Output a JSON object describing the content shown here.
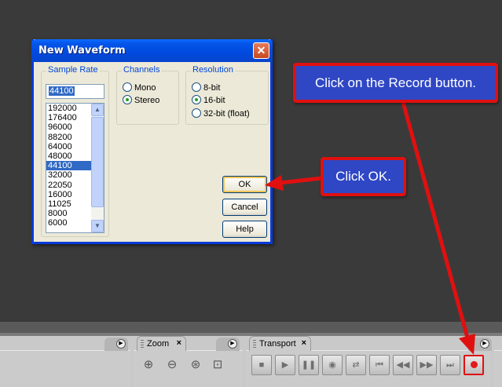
{
  "dialog": {
    "title": "New Waveform",
    "close_glyph": "✕",
    "sample_rate": {
      "label": "Sample Rate",
      "value": "44100",
      "options": [
        "192000",
        "176400",
        "96000",
        "88200",
        "64000",
        "48000",
        "44100",
        "32000",
        "22050",
        "16000",
        "11025",
        "8000",
        "6000"
      ],
      "selected": "44100"
    },
    "channels": {
      "label": "Channels",
      "options": [
        "Mono",
        "Stereo"
      ],
      "selected": "Stereo"
    },
    "resolution": {
      "label": "Resolution",
      "options": [
        "8-bit",
        "16-bit",
        "32-bit (float)"
      ],
      "selected": "16-bit"
    },
    "buttons": {
      "ok": "OK",
      "cancel": "Cancel",
      "help": "Help"
    }
  },
  "callouts": {
    "record": "Click on the Record button.",
    "ok": "Click OK."
  },
  "panels": {
    "zoom_tab": "Zoom",
    "transport_tab": "Transport",
    "tab_close_glyph": "×"
  },
  "icons": {
    "zoom_tools": [
      "zoom-in-icon",
      "zoom-out-icon",
      "zoom-selection-icon",
      "zoom-fit-icon"
    ],
    "transport": [
      "stop-icon",
      "play-icon",
      "pause-icon",
      "play-cursor-icon",
      "loop-icon",
      "go-to-start-icon",
      "rewind-icon",
      "fast-forward-icon",
      "go-to-end-icon",
      "record-icon"
    ]
  },
  "colors": {
    "callout_fill": "#2f47c4",
    "callout_border": "#e01010",
    "arrow": "#e01010",
    "titlebar": "#0555e8"
  }
}
